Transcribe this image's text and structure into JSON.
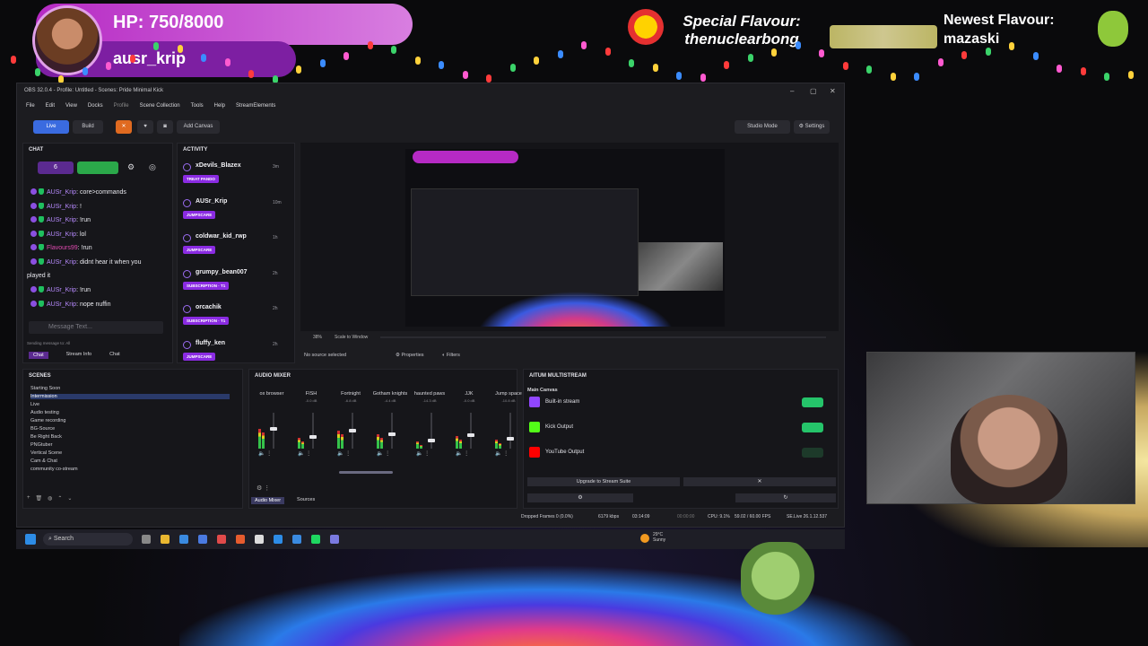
{
  "overlay": {
    "hp_text": "HP: 750/8000",
    "username": "ausr_krip",
    "special_label": "Special Flavour:",
    "special_name": "thenuclearbong",
    "newest_label": "Newest Flavour:",
    "newest_name": "mazaski"
  },
  "obs": {
    "title": "OBS 32.0.4 - Profile: Untitled - Scenes: Pride Minimal Kick",
    "menu": [
      "File",
      "Edit",
      "View",
      "Docks",
      "Profile",
      "Scene Collection",
      "Tools",
      "Help",
      "StreamElements"
    ],
    "toolbar": {
      "live": "Live",
      "build": "Build",
      "add_canvas": "Add Canvas",
      "studio_mode": "Studio Mode",
      "settings": "Settings"
    },
    "chat": {
      "title": "CHAT",
      "viewer_count": "6",
      "lines": [
        {
          "user": "AUSr_Krip",
          "msg": ": core>commands"
        },
        {
          "user": "AUSr_Krip",
          "msg": ": !"
        },
        {
          "user": "AUSr_Krip",
          "msg": ": !run"
        },
        {
          "user": "AUSr_Krip",
          "msg": ": lol"
        },
        {
          "user": "Flavours99",
          "msg": ": !run"
        },
        {
          "user": "AUSr_Krip",
          "msg": ": didnt hear it when you"
        },
        {
          "user": "",
          "msg": "played it"
        },
        {
          "user": "AUSr_Krip",
          "msg": ": !run"
        },
        {
          "user": "AUSr_Krip",
          "msg": ": nope nuffin"
        }
      ],
      "placeholder": "Message Text...",
      "sending_to": "Sending message to: All",
      "tabs": [
        "Chat",
        "Stream Info",
        "Chat"
      ]
    },
    "activity": {
      "title": "ACTIVITY",
      "items": [
        {
          "name": "xDevils_Blazex",
          "tag": "TREAT PANDO",
          "time": "3m"
        },
        {
          "name": "AUSr_Krip",
          "tag": "JUMPSCARE",
          "time": "10m"
        },
        {
          "name": "coldwar_kid_rwp",
          "tag": "JUMPSCARE",
          "time": "1h"
        },
        {
          "name": "grumpy_bean007",
          "tag": "SUBSCRIPTION · T1",
          "time": "2h"
        },
        {
          "name": "orcachik",
          "tag": "SUBSCRIPTION · T1",
          "time": "2h"
        },
        {
          "name": "fluffy_ken",
          "tag": "JUMPSCARE",
          "time": "2h"
        }
      ]
    },
    "preview_bar": {
      "zoom": "38%",
      "scale": "Scale to Window"
    },
    "source_bar": {
      "no_source": "No source selected",
      "properties": "Properties",
      "filters": "Filters"
    },
    "scenes": {
      "title": "SCENES",
      "items": [
        "Starting Soon",
        "Intermission",
        "Live",
        "Audio testing",
        "Game recording",
        "BG-Source",
        "Be Right Back",
        "PNGtuber",
        "Vertical Scene",
        "Cam & Chat",
        "community co-stream"
      ]
    },
    "mixer": {
      "title": "AUDIO MIXER",
      "channels": [
        {
          "name": "ox browser",
          "db": "",
          "level": 0.55
        },
        {
          "name": "FISH",
          "db": "-0.0 dB",
          "level": 0.3
        },
        {
          "name": "Fortnight",
          "db": "-6.8 dB",
          "level": 0.5
        },
        {
          "name": "Gotham knights",
          "db": "-4.4 dB",
          "level": 0.4
        },
        {
          "name": "haunted paws",
          "db": "-14.3 dB",
          "level": 0.2
        },
        {
          "name": "JJK",
          "db": "-0.0 dB",
          "level": 0.35
        },
        {
          "name": "Jump space",
          "db": "-10.8 dB",
          "level": 0.25
        }
      ],
      "tabs": [
        "Audio Mixer",
        "Sources"
      ]
    },
    "multistream": {
      "title": "AITUM MULTISTREAM",
      "canvas": "Main Canvas",
      "outputs": [
        {
          "name": "Built-in stream",
          "color": "#9146ff"
        },
        {
          "name": "Kick Output",
          "color": "#53fc18"
        },
        {
          "name": "YouTube Output",
          "color": "#ff0000"
        }
      ],
      "upgrade": "Upgrade to Stream Suite"
    },
    "status": {
      "dropped": "Dropped Frames 0 (0.0%)",
      "kbps": "6179 kbps",
      "time": "03:14:09",
      "rec": "00:00:00",
      "cpu": "CPU: 9.1%",
      "fps": "59.02 / 60.00 FPS",
      "live": "SE.Live 26.1.12.537"
    }
  },
  "taskbar": {
    "search": "Search",
    "weather_temp": "29°C",
    "weather_desc": "Sunny"
  }
}
